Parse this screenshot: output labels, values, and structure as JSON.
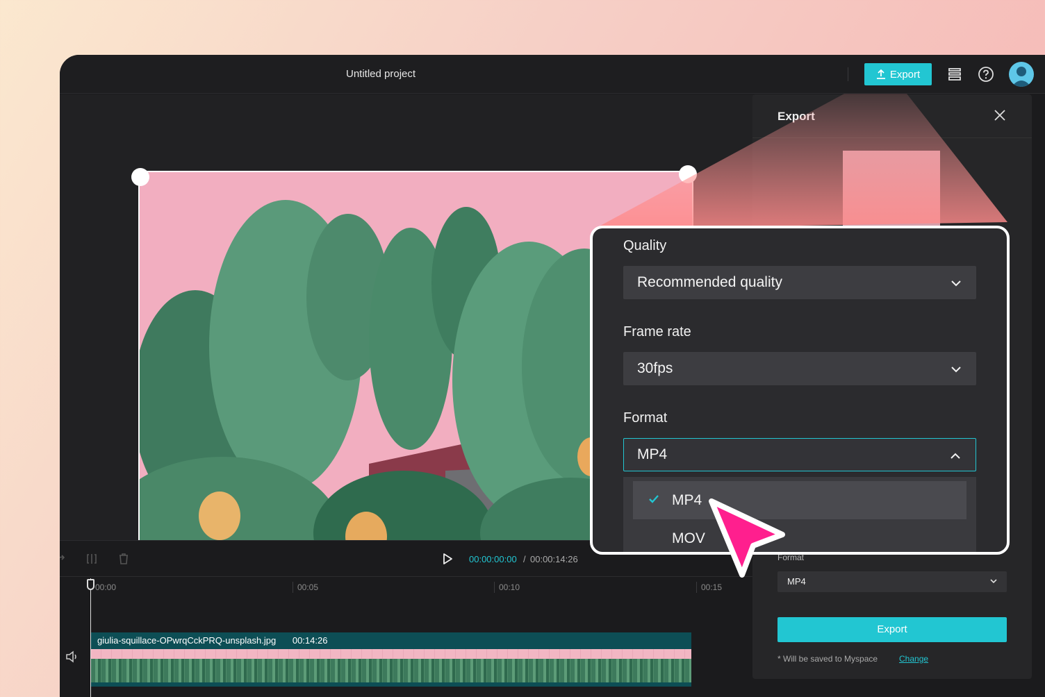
{
  "topbar": {
    "project_title": "Untitled project",
    "export_label": "Export",
    "icons": [
      "upload-icon",
      "layers-icon",
      "help-icon",
      "user-avatar"
    ]
  },
  "timeline": {
    "current_time": "00:00:00:00",
    "separator": "/",
    "total_time": "00:00:14:26",
    "ticks": [
      "00:00",
      "00:05",
      "00:10",
      "00:15"
    ],
    "clip_name": "giulia-squillace-OPwrqCckPRQ-unsplash.jpg",
    "clip_duration": "00:14:26"
  },
  "export_panel": {
    "title": "Export",
    "format_label": "Format",
    "format_value": "MP4",
    "export_button": "Export",
    "note": "* Will be saved to Myspace",
    "change_link": "Change"
  },
  "zoom_panel": {
    "quality_label": "Quality",
    "quality_value": "Recommended quality",
    "frame_rate_label": "Frame rate",
    "frame_rate_value": "30fps",
    "format_label": "Format",
    "format_value": "MP4",
    "format_options": [
      {
        "label": "MP4",
        "selected": true
      },
      {
        "label": "MOV",
        "selected": false
      }
    ]
  },
  "colors": {
    "accent": "#22c6d2",
    "cursor": "#ff1f8e",
    "panel_bg": "#262628"
  }
}
